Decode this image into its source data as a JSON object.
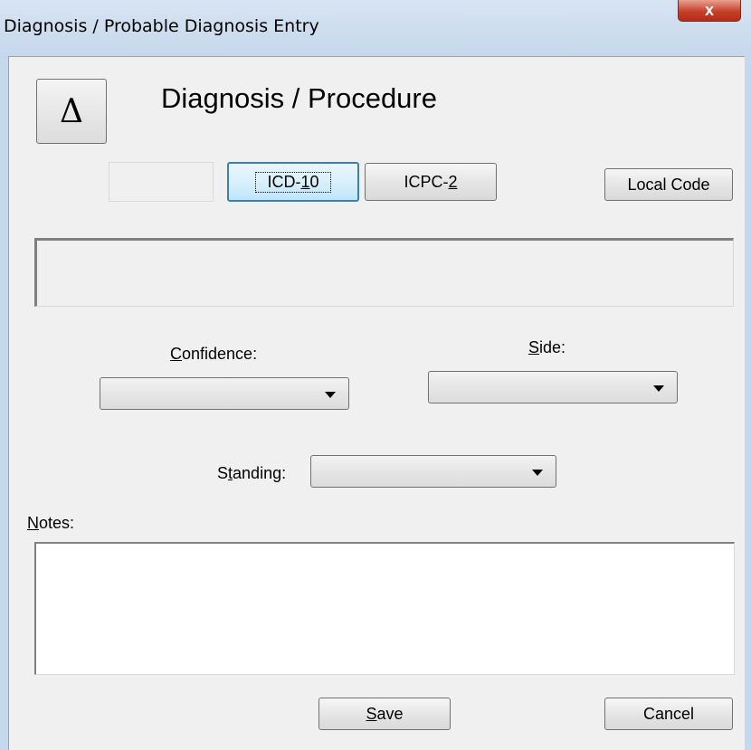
{
  "window": {
    "title": "Diagnosis / Probable Diagnosis Entry",
    "close_glyph": "x"
  },
  "header": {
    "delta_glyph": "Δ",
    "title": "Diagnosis / Procedure"
  },
  "code_buttons": {
    "icd10": {
      "pre": "ICD-",
      "u": "1",
      "post": "0"
    },
    "icpc2": {
      "pre": "ICPC-",
      "u": "2",
      "post": ""
    },
    "local_code": "Local Code"
  },
  "confidence": {
    "pre": "",
    "u": "C",
    "post": "onfidence:",
    "value": ""
  },
  "side": {
    "pre": "",
    "u": "S",
    "post": "ide:",
    "value": ""
  },
  "standing": {
    "pre": "S",
    "u": "t",
    "post": "anding:",
    "value": ""
  },
  "notes": {
    "pre": "",
    "u": "N",
    "post": "otes:",
    "value": ""
  },
  "footer": {
    "save": {
      "pre": "",
      "u": "S",
      "post": "ave"
    },
    "cancel": "Cancel"
  }
}
